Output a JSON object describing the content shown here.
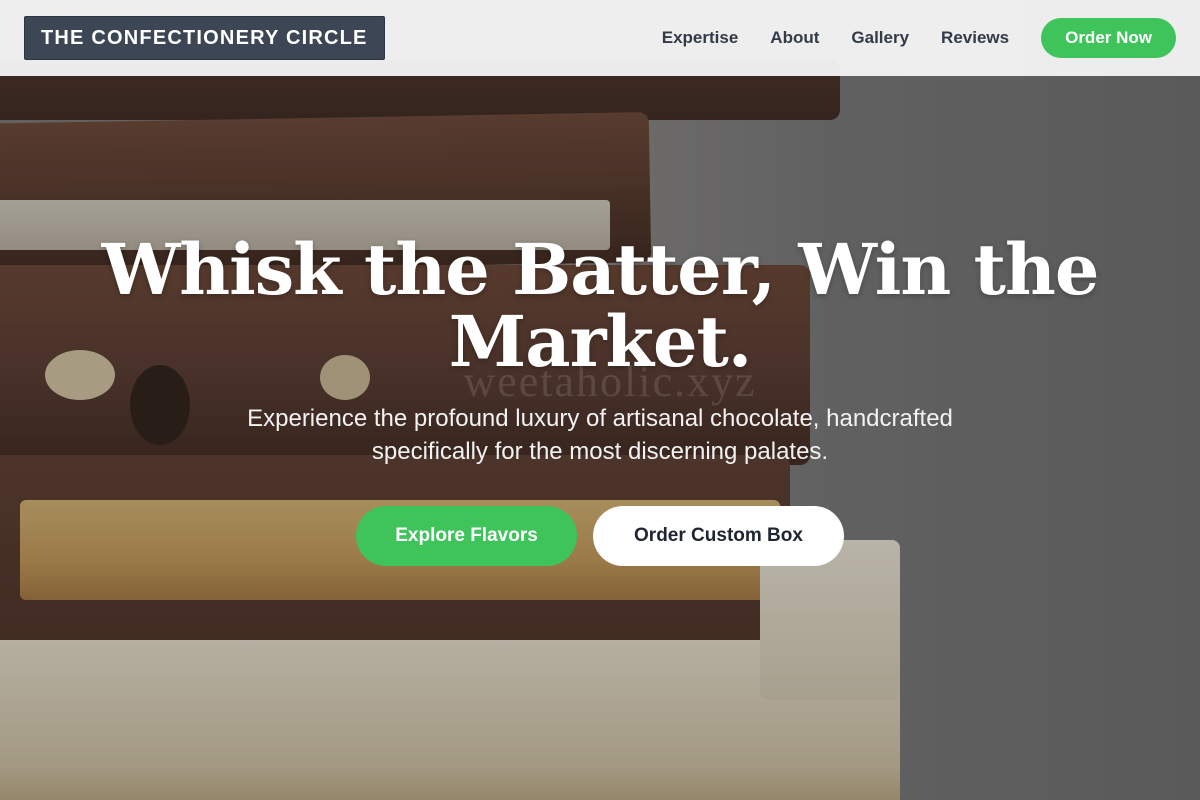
{
  "header": {
    "logo_text": "THE CONFECTIONERY CIRCLE",
    "nav": [
      {
        "label": "Expertise"
      },
      {
        "label": "About"
      },
      {
        "label": "Gallery"
      },
      {
        "label": "Reviews"
      }
    ],
    "cta_label": "Order Now"
  },
  "hero": {
    "headline": "Whisk the Batter, Win the Market.",
    "subtitle": "Experience the profound luxury of artisanal chocolate, handcrafted specifically for the most discerning palates.",
    "watermark": "weetaholic.xyz",
    "primary_button": "Explore Flavors",
    "secondary_button": "Order Custom Box",
    "background_image": "stacked chocolate bars"
  },
  "colors": {
    "accent": "#3fc35b",
    "logo_bg": "#3d4655",
    "header_bg": "#f4f4f4",
    "nav_text": "#333b48"
  }
}
